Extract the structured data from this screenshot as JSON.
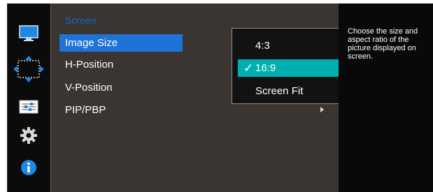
{
  "menu": {
    "section_title": "Screen",
    "items": [
      {
        "label": "Image Size",
        "selected": true
      },
      {
        "label": "H-Position"
      },
      {
        "label": "V-Position"
      },
      {
        "label": "PIP/PBP",
        "has_submenu": true
      }
    ]
  },
  "submenu": {
    "options": [
      {
        "label": "4:3"
      },
      {
        "label": "16:9",
        "selected": true
      },
      {
        "label": "Screen Fit"
      }
    ]
  },
  "help": {
    "text": "Choose the size and aspect ratio of the picture displayed on screen."
  },
  "rail": {
    "icons": [
      "monitor-icon",
      "move-arrows-icon",
      "sliders-icon",
      "gear-icon",
      "info-icon"
    ]
  },
  "colors": {
    "menu_bg": "#3a3530",
    "selected_item": "#1e73d6",
    "submenu_selected": "#00b0b0",
    "section_title": "#1565c8",
    "accent_blue": "#1e88e5"
  }
}
